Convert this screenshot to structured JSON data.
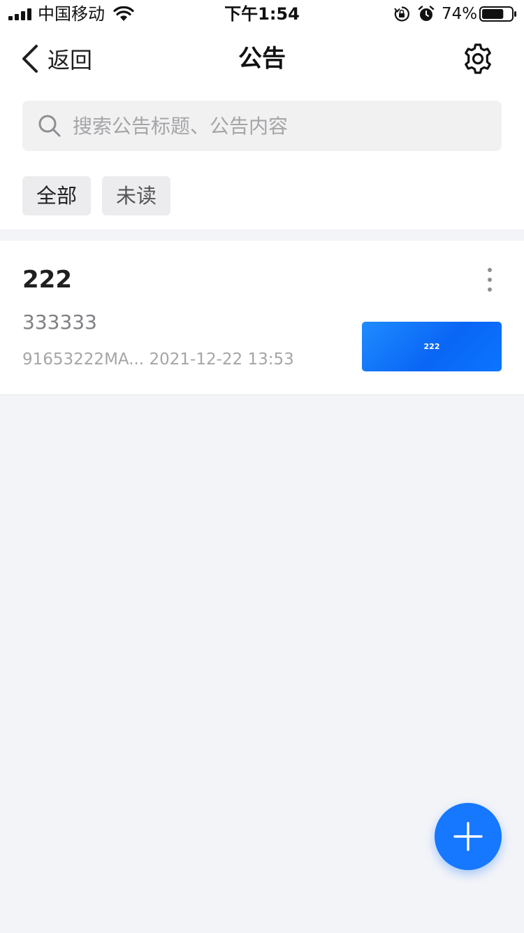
{
  "status_bar": {
    "carrier": "中国移动",
    "time": "下午1:54",
    "battery_percent": "74%",
    "battery_level": 0.74,
    "icons": [
      "signal-icon",
      "wifi-icon",
      "rotation-lock-icon",
      "alarm-icon",
      "battery-icon"
    ]
  },
  "nav": {
    "back_label": "返回",
    "title": "公告",
    "back_icon": "chevron-left-icon",
    "settings_icon": "gear-icon"
  },
  "search": {
    "placeholder": "搜索公告标题、公告内容",
    "value": "",
    "icon": "search-icon"
  },
  "filters": [
    {
      "label": "全部",
      "active": true
    },
    {
      "label": "未读",
      "active": false
    }
  ],
  "notices": [
    {
      "title": "222",
      "content": "333333",
      "meta": "91653222MA... 2021-12-22 13:53",
      "thumbnail_text": "222"
    }
  ],
  "fab": {
    "icon": "plus-icon"
  },
  "colors": {
    "accent": "#1677ff",
    "background": "#f3f4f8",
    "surface": "#ffffff",
    "chip": "#ececee",
    "muted_text": "#a5a5a8"
  }
}
